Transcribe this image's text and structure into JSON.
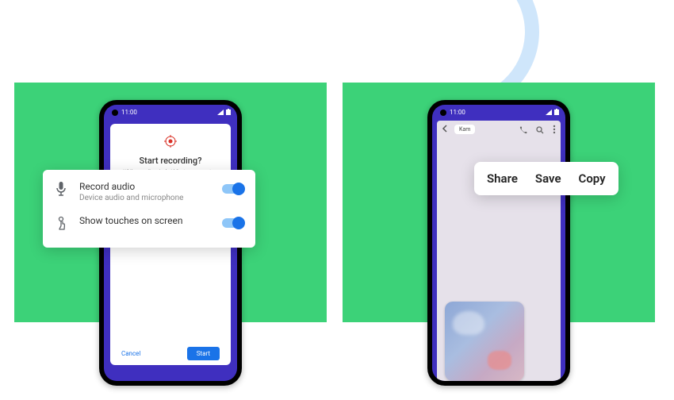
{
  "status": {
    "time": "11:00"
  },
  "left": {
    "dialog": {
      "title": "Start recording?",
      "description": "While recording, Android System can capture any sensitive information that's visible on your screen or played on your device. This includes passwords, payment",
      "cancel": "Cancel",
      "start": "Start"
    },
    "options": {
      "record_audio": {
        "title": "Record audio",
        "subtitle": "Device audio and microphone"
      },
      "show_touches": {
        "title": "Show touches on screen"
      }
    }
  },
  "right": {
    "chat": {
      "contact": "Kam"
    },
    "menu": {
      "share": "Share",
      "save": "Save",
      "copy": "Copy"
    }
  }
}
